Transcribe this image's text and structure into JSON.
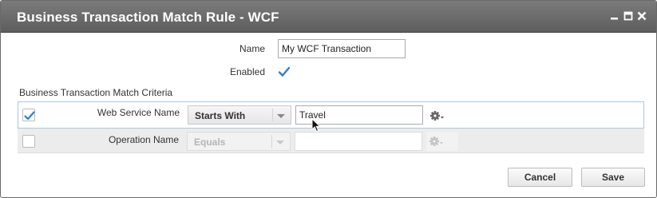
{
  "window": {
    "title": "Business Transaction Match Rule - WCF",
    "controls": [
      "minimize-icon",
      "maximize-icon",
      "close-icon"
    ]
  },
  "form": {
    "name_label": "Name",
    "name_value": "My WCF Transaction",
    "enabled_label": "Enabled",
    "enabled_checked": true
  },
  "criteria": {
    "section_label": "Business Transaction Match Criteria",
    "rows": [
      {
        "checked": true,
        "label": "Web Service Name",
        "operator": "Starts With",
        "value": "Travel",
        "enabled": true
      },
      {
        "checked": false,
        "label": "Operation Name",
        "operator": "Equals",
        "value": "",
        "enabled": false
      }
    ]
  },
  "footer": {
    "cancel_label": "Cancel",
    "save_label": "Save"
  },
  "colors": {
    "titlebar": "#6a6a6a",
    "check_blue": "#2a7fd4",
    "row_highlight_border": "#a9c7e3"
  }
}
